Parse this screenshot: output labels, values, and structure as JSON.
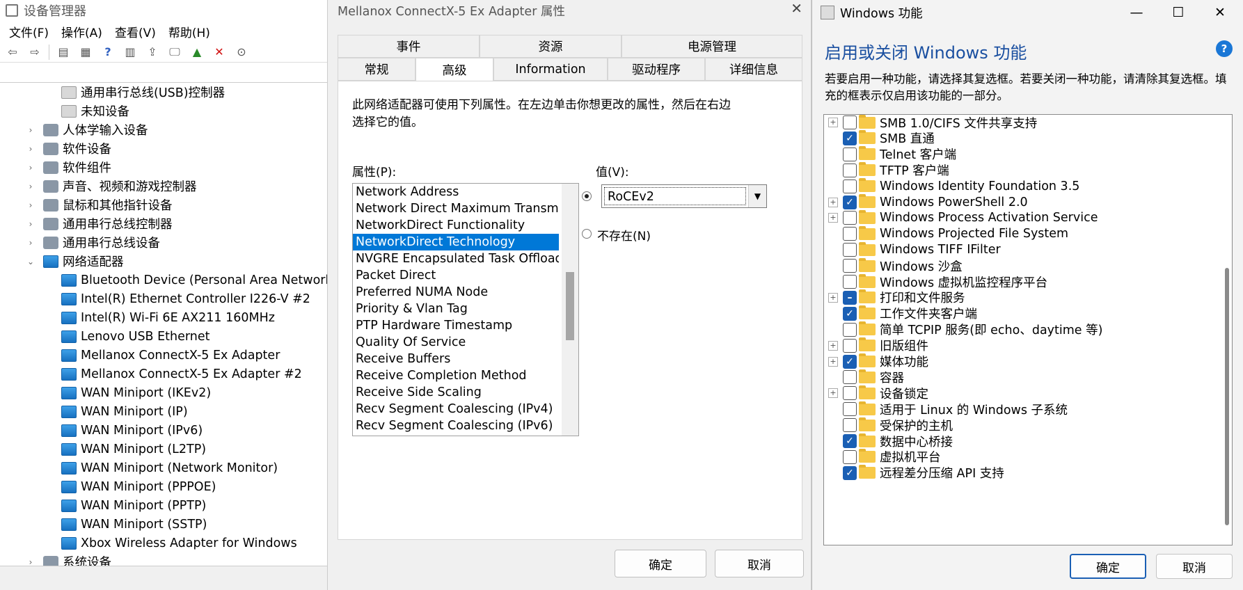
{
  "device_manager": {
    "title": "设备管理器",
    "menu": [
      "文件(F)",
      "操作(A)",
      "查看(V)",
      "帮助(H)"
    ],
    "tree": [
      {
        "label": "通用串行总线(USB)控制器",
        "level": 2,
        "icon": "warning-device-icon"
      },
      {
        "label": "未知设备",
        "level": 2,
        "icon": "warning-device-icon"
      },
      {
        "label": "人体学输入设备",
        "level": 1,
        "expander": "›",
        "icon": "hid-icon"
      },
      {
        "label": "软件设备",
        "level": 1,
        "expander": "›",
        "icon": "software-device-icon"
      },
      {
        "label": "软件组件",
        "level": 1,
        "expander": "›",
        "icon": "software-component-icon"
      },
      {
        "label": "声音、视频和游戏控制器",
        "level": 1,
        "expander": "›",
        "icon": "speaker-icon"
      },
      {
        "label": "鼠标和其他指针设备",
        "level": 1,
        "expander": "›",
        "icon": "mouse-icon"
      },
      {
        "label": "通用串行总线控制器",
        "level": 1,
        "expander": "›",
        "icon": "usb-icon"
      },
      {
        "label": "通用串行总线设备",
        "level": 1,
        "expander": "›",
        "icon": "usb-icon"
      },
      {
        "label": "网络适配器",
        "level": 1,
        "expander": "⌄",
        "icon": "network-adapter-icon"
      },
      {
        "label": "Bluetooth Device (Personal Area Network)",
        "level": 2,
        "icon": "network-adapter-icon"
      },
      {
        "label": "Intel(R) Ethernet Controller I226-V #2",
        "level": 2,
        "icon": "network-adapter-icon"
      },
      {
        "label": "Intel(R) Wi-Fi 6E AX211 160MHz",
        "level": 2,
        "icon": "network-adapter-icon"
      },
      {
        "label": "Lenovo USB Ethernet",
        "level": 2,
        "icon": "network-adapter-icon"
      },
      {
        "label": "Mellanox ConnectX-5 Ex Adapter",
        "level": 2,
        "icon": "network-adapter-icon"
      },
      {
        "label": "Mellanox ConnectX-5 Ex Adapter #2",
        "level": 2,
        "icon": "network-adapter-icon"
      },
      {
        "label": "WAN Miniport (IKEv2)",
        "level": 2,
        "icon": "network-adapter-icon"
      },
      {
        "label": "WAN Miniport (IP)",
        "level": 2,
        "icon": "network-adapter-icon"
      },
      {
        "label": "WAN Miniport (IPv6)",
        "level": 2,
        "icon": "network-adapter-icon"
      },
      {
        "label": "WAN Miniport (L2TP)",
        "level": 2,
        "icon": "network-adapter-icon"
      },
      {
        "label": "WAN Miniport (Network Monitor)",
        "level": 2,
        "icon": "network-adapter-icon"
      },
      {
        "label": "WAN Miniport (PPPOE)",
        "level": 2,
        "icon": "network-adapter-icon"
      },
      {
        "label": "WAN Miniport (PPTP)",
        "level": 2,
        "icon": "network-adapter-icon"
      },
      {
        "label": "WAN Miniport (SSTP)",
        "level": 2,
        "icon": "network-adapter-icon"
      },
      {
        "label": "Xbox Wireless Adapter for Windows",
        "level": 2,
        "icon": "network-adapter-icon"
      },
      {
        "label": "系统设备",
        "level": 1,
        "expander": "›",
        "icon": "system-device-icon"
      }
    ]
  },
  "properties": {
    "title": "Mellanox ConnectX-5 Ex Adapter 属性",
    "tabs_back": [
      "事件",
      "资源",
      "电源管理"
    ],
    "tabs_front": [
      "常规",
      "高级",
      "Information",
      "驱动程序",
      "详细信息"
    ],
    "active_tab": "高级",
    "description": "此网络适配器可使用下列属性。在左边单击你想更改的属性，然后在右边选择它的值。",
    "property_label": "属性(P):",
    "value_label": "值(V):",
    "properties_list": [
      "Network Address",
      "Network Direct Maximum Transmi",
      "NetworkDirect Functionality",
      "NetworkDirect Technology",
      "NVGRE Encapsulated Task Offload",
      "Packet Direct",
      "Preferred NUMA Node",
      "Priority & Vlan Tag",
      "PTP Hardware Timestamp",
      "Quality Of Service",
      "Receive Buffers",
      "Receive Completion Method",
      "Receive Side Scaling",
      "Recv Segment Coalescing (IPv4)",
      "Recv Segment Coalescing (IPv6)"
    ],
    "selected_property": "NetworkDirect Technology",
    "value": "RoCEv2",
    "not_present_label": "不存在(N)",
    "ok": "确定",
    "cancel": "取消"
  },
  "windows_features": {
    "title": "Windows 功能",
    "heading": "启用或关闭 Windows 功能",
    "description": "若要启用一种功能，请选择其复选框。若要关闭一种功能，请清除其复选框。填充的框表示仅启用该功能的一部分。",
    "features": [
      {
        "label": "SMB 1.0/CIFS 文件共享支持",
        "state": "unchecked",
        "expandable": true
      },
      {
        "label": "SMB 直通",
        "state": "checked",
        "expandable": false
      },
      {
        "label": "Telnet 客户端",
        "state": "unchecked",
        "expandable": false
      },
      {
        "label": "TFTP 客户端",
        "state": "unchecked",
        "expandable": false
      },
      {
        "label": "Windows Identity Foundation 3.5",
        "state": "unchecked",
        "expandable": false
      },
      {
        "label": "Windows PowerShell 2.0",
        "state": "checked",
        "expandable": true
      },
      {
        "label": "Windows Process Activation Service",
        "state": "unchecked",
        "expandable": true
      },
      {
        "label": "Windows Projected File System",
        "state": "unchecked",
        "expandable": false
      },
      {
        "label": "Windows TIFF IFilter",
        "state": "unchecked",
        "expandable": false
      },
      {
        "label": "Windows 沙盒",
        "state": "unchecked",
        "expandable": false
      },
      {
        "label": "Windows 虚拟机监控程序平台",
        "state": "unchecked",
        "expandable": false
      },
      {
        "label": "打印和文件服务",
        "state": "partial",
        "expandable": true
      },
      {
        "label": "工作文件夹客户端",
        "state": "checked",
        "expandable": false
      },
      {
        "label": "简单 TCPIP 服务(即 echo、daytime 等)",
        "state": "unchecked",
        "expandable": false
      },
      {
        "label": "旧版组件",
        "state": "unchecked",
        "expandable": true
      },
      {
        "label": "媒体功能",
        "state": "checked",
        "expandable": true
      },
      {
        "label": "容器",
        "state": "unchecked",
        "expandable": false
      },
      {
        "label": "设备锁定",
        "state": "unchecked",
        "expandable": true
      },
      {
        "label": "适用于 Linux 的 Windows 子系统",
        "state": "unchecked",
        "expandable": false
      },
      {
        "label": "受保护的主机",
        "state": "unchecked",
        "expandable": false
      },
      {
        "label": "数据中心桥接",
        "state": "checked",
        "expandable": false
      },
      {
        "label": "虚拟机平台",
        "state": "unchecked",
        "expandable": false
      },
      {
        "label": "远程差分压缩 API 支持",
        "state": "checked",
        "expandable": false
      }
    ],
    "ok": "确定",
    "cancel": "取消"
  }
}
